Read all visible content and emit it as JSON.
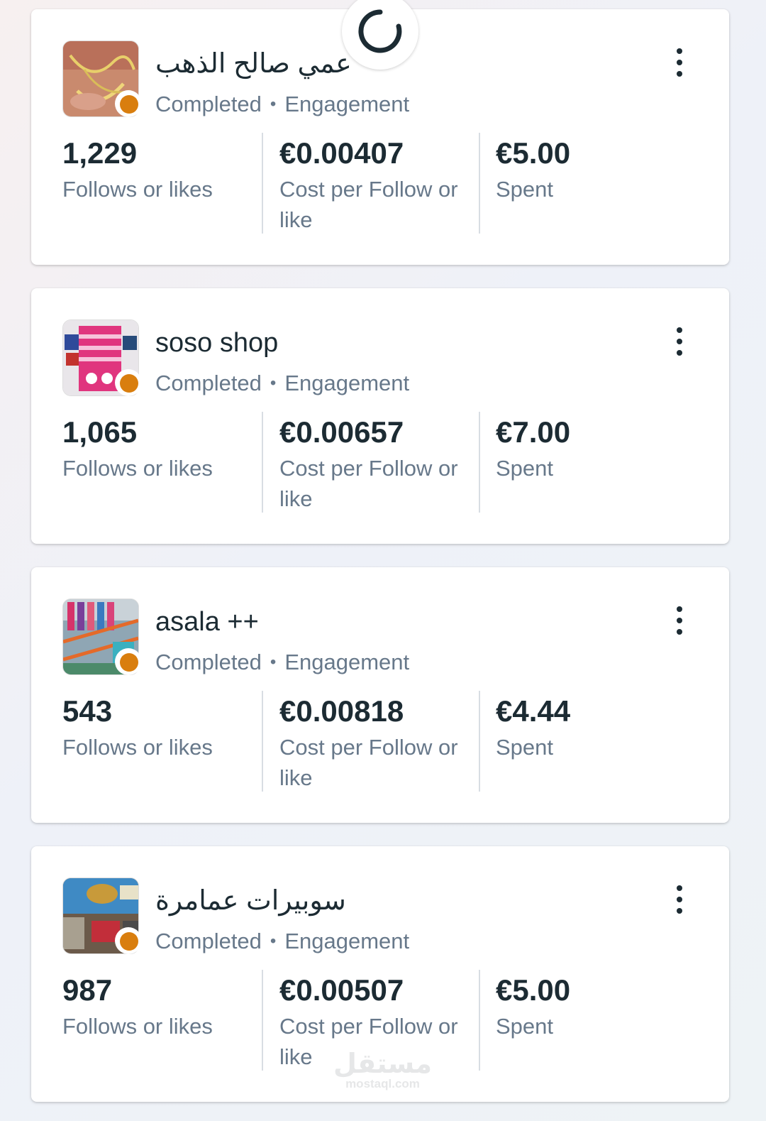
{
  "campaigns": [
    {
      "title": "عمي صالح الذهب",
      "status": "Completed",
      "objective": "Engagement",
      "separator": "•",
      "metrics": [
        {
          "value": "1,229",
          "label": "Follows or likes"
        },
        {
          "value": "€0.00407",
          "label": "Cost per Follow or like"
        },
        {
          "value": "€5.00",
          "label": "Spent"
        }
      ]
    },
    {
      "title": "soso shop",
      "status": "Completed",
      "objective": "Engagement",
      "separator": "•",
      "metrics": [
        {
          "value": "1,065",
          "label": "Follows or likes"
        },
        {
          "value": "€0.00657",
          "label": "Cost per Follow or like"
        },
        {
          "value": "€7.00",
          "label": "Spent"
        }
      ]
    },
    {
      "title": "asala ++",
      "status": "Completed",
      "objective": "Engagement",
      "separator": "•",
      "metrics": [
        {
          "value": "543",
          "label": "Follows or likes"
        },
        {
          "value": "€0.00818",
          "label": "Cost per Follow or like"
        },
        {
          "value": "€4.44",
          "label": "Spent"
        }
      ]
    },
    {
      "title": "سوبيرات عمامرة",
      "status": "Completed",
      "objective": "Engagement",
      "separator": "•",
      "metrics": [
        {
          "value": "987",
          "label": "Follows or likes"
        },
        {
          "value": "€0.00507",
          "label": "Cost per Follow or like"
        },
        {
          "value": "€5.00",
          "label": "Spent"
        }
      ]
    }
  ],
  "status_dot_color": "#d97e0e",
  "watermark": {
    "arabic": "مستقل",
    "latin": "mostaql.com"
  },
  "icons": {
    "menu": "more-vertical-icon",
    "loading": "loading-spinner-icon"
  }
}
